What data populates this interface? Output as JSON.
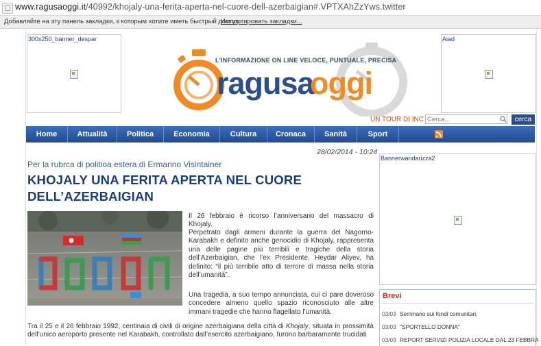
{
  "browser": {
    "url_host": "www.ragusaoggi.it",
    "url_path": "/40992/khojaly-una-ferita-aperta-nel-cuore-dell-azerbaigian#.VPTXAhZzYws.twitter",
    "bookmarks_hint": "Добавляйте на эту панель закладки, к которым хотите иметь быстрый доступ.",
    "bookmarks_import": "Импортировать закладки..."
  },
  "banners": {
    "left_label": "300x250_banner_despar",
    "right_label": "Aiad",
    "sidebar_label": "Bannerwandarizza2"
  },
  "logo": {
    "tagline": "L'INFORMAZIONE ON LINE VELOCE, PUNTUALE, PRECISA",
    "brand_part1": "ragusa",
    "brand_part2": "oggi",
    "colors": {
      "orange": "#f08a24",
      "blue": "#2a4f8c"
    }
  },
  "topbar": {
    "tour_link": "UN TOUR DI INC",
    "search_placeholder": "Cerca...",
    "search_button": "cerca"
  },
  "nav": {
    "items": [
      {
        "label": "Home"
      },
      {
        "label": "Attualità"
      },
      {
        "label": "Politica"
      },
      {
        "label": "Economia"
      },
      {
        "label": "Cultura"
      },
      {
        "label": "Cronaca"
      },
      {
        "label": "Sanità"
      },
      {
        "label": "Sport"
      }
    ],
    "rss_icon": "rss-icon"
  },
  "article": {
    "date": "28/02/2014 - 10:24",
    "rubric": "Per la rubrca di politioa estera di Ermanno Visintainer",
    "title_line1": "KHOJALY UNA FERITA APERTA NEL CUORE",
    "title_line2": "DELL’AZERBAIGIAN",
    "p1": "Il 26 febbraio è ricorso l’anniversario del massacro di Khojaly.",
    "p2": "Perpetrato dagli armeni durante la guerra del Nagorno-Karabakh e definito anche genocidio di Khojaly, rappresenta una delle pagine più terribili e tragiche della storia dell’Azerbaigian, che l’ex Presidente, Heydar Aliyev, ha definito: “il più terribile atto di terrore di massa nella storia dell’umanità”.",
    "p3": "Una tragedia, a suo tempo annunciata, cui ci pare doveroso concedere almeno quello spazio riconosciuto alle altre immani tragedie che hanno flagellato l’umanità.",
    "p4_a": "Tra il 25 e il 26 febbraio 1992, centinaia di civili di origine azerbaigiana della città di ",
    "p4_em": "Khojaly",
    "p4_b": ", situata in prossimità dell’unico aeroporto presente nel Karabakh, controllato dall’esercito azerbaigiano, furono barbaramente trucidati"
  },
  "brevi": {
    "title": "Brevi",
    "items": [
      {
        "date": "03/03",
        "text": "Seminario sui fondi comunitari."
      },
      {
        "date": "03/03",
        "text": "\"SPORTELLO DONNA\""
      },
      {
        "date": "03/03",
        "text": "REPORT SERVIZI POLIZIA LOCALE DAL 23 FEBBRA"
      }
    ]
  }
}
